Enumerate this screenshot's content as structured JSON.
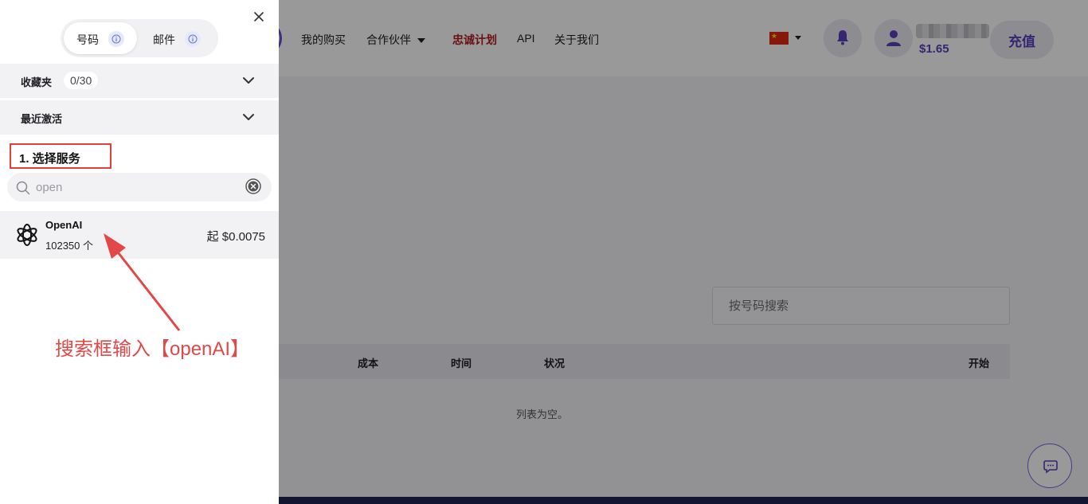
{
  "nav": {
    "items": [
      "我的购买",
      "合作伙伴",
      "忠诚计划",
      "API",
      "关于我们"
    ],
    "balance": "$1.65",
    "recharge_label": "充值"
  },
  "main": {
    "search_placeholder": "按号码搜索",
    "table_headers": [
      "成本",
      "时间",
      "状况",
      "开始"
    ],
    "empty_text": "列表为空。"
  },
  "panel": {
    "tabs": [
      {
        "label": "号码",
        "active": true
      },
      {
        "label": "邮件",
        "active": false
      }
    ],
    "favorites": {
      "label": "收藏夹",
      "count": "0/30"
    },
    "recent": {
      "label": "最近激活"
    },
    "step_title": "1. 选择服务",
    "search": {
      "value": "open"
    },
    "service": {
      "name": "OpenAI",
      "count": "102350 个",
      "price": "起 $0.0075"
    },
    "annotation": "搜索框输入【openAI】"
  },
  "colors": {
    "accent": "#5b3fbd",
    "loyalty": "#b11b1b",
    "annotation": "#e34848",
    "overlay": "rgba(0,0,0,0.40)"
  }
}
